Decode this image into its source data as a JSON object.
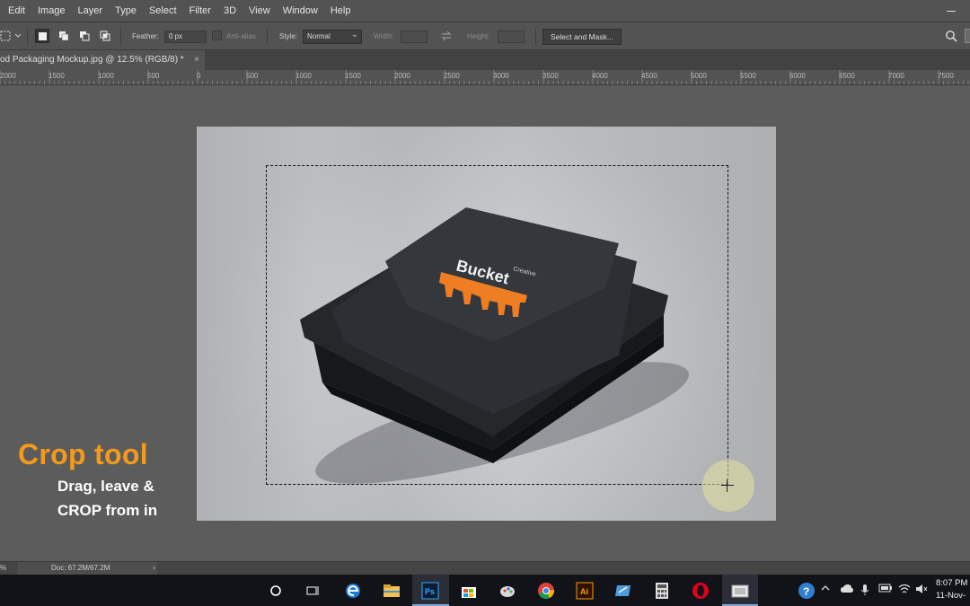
{
  "menu": {
    "items": [
      "Edit",
      "Image",
      "Layer",
      "Type",
      "Select",
      "Filter",
      "3D",
      "View",
      "Window",
      "Help"
    ]
  },
  "options": {
    "feather_label": "Feather:",
    "feather_value": "0 px",
    "anti_alias_label": "Anti-alias",
    "style_label": "Style:",
    "style_value": "Normal",
    "width_label": "Width:",
    "height_label": "Height:",
    "select_mask_label": "Select and Mask..."
  },
  "document_tab": {
    "title": "od Packaging Mockup.jpg @ 12.5% (RGB/8) *",
    "close": "×"
  },
  "ruler": {
    "labels": [
      "2000",
      "1500",
      "1000",
      "500",
      "0",
      "500",
      "1000",
      "1500",
      "2000",
      "2500",
      "3000",
      "3500",
      "4000",
      "4500",
      "5000",
      "5500",
      "6000",
      "6500",
      "7000",
      "7500"
    ]
  },
  "image": {
    "brand_text": "Bucket",
    "brand_small": "Creative"
  },
  "overlay": {
    "title": "Crop tool",
    "line1": "Drag, leave &",
    "line2": "CROP from in"
  },
  "status": {
    "zoom": "%",
    "doc_info": "Doc: 67.2M/67.2M",
    "arrow": "›"
  },
  "taskbar": {
    "clock_time": "8:07 PM",
    "clock_date": "11-Nov-"
  },
  "colors": {
    "accent_orange": "#f39a1c",
    "ps_blue": "#31a8ff",
    "ui_dark": "#535353"
  }
}
